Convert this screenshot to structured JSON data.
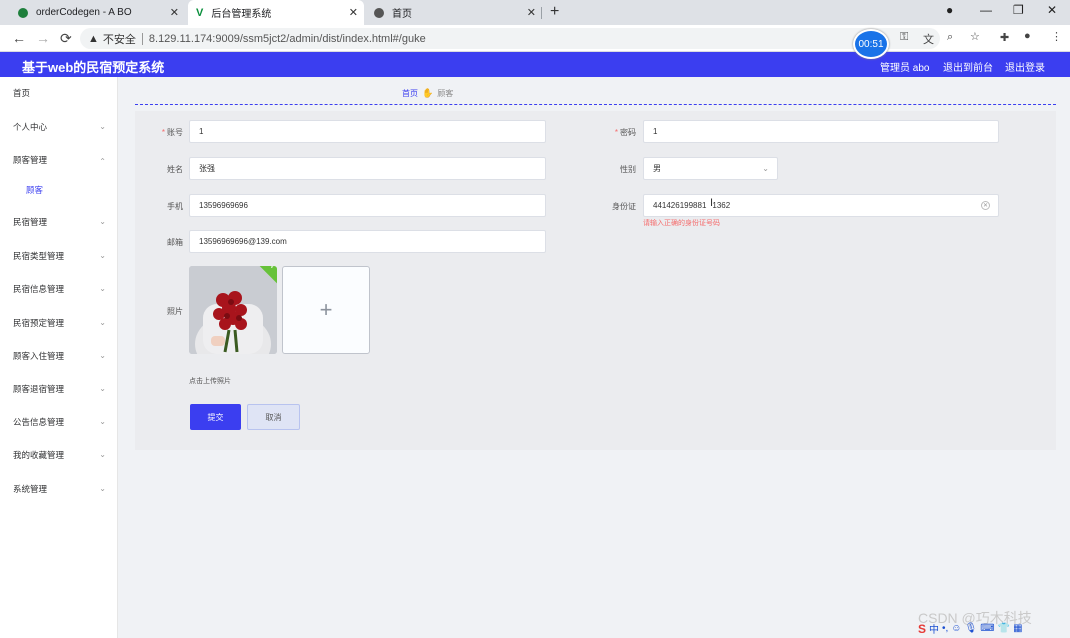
{
  "browser": {
    "tabs": [
      {
        "title": "orderCodegen - A BO",
        "active": false
      },
      {
        "title": "后台管理系统",
        "active": true
      },
      {
        "title": "首页",
        "active": false
      }
    ],
    "new_tab_symbol": "+",
    "address": {
      "security_text": "不安全",
      "url": "8.129.11.174:9009/ssm5jct2/admin/dist/index.html#/guke"
    },
    "timer": "00:51"
  },
  "header": {
    "title": "基于web的民宿预定系统",
    "user": "管理员 abo",
    "to_front": "退出到前台",
    "logout": "退出登录"
  },
  "sidebar": {
    "items": [
      {
        "label": "首页",
        "expandable": false
      },
      {
        "label": "个人中心",
        "expandable": true
      },
      {
        "label": "顾客管理",
        "expandable": true,
        "open": true
      },
      {
        "label": "顾客",
        "sub": true
      },
      {
        "label": "民宿管理",
        "expandable": true
      },
      {
        "label": "民宿类型管理",
        "expandable": true
      },
      {
        "label": "民宿信息管理",
        "expandable": true
      },
      {
        "label": "民宿预定管理",
        "expandable": true
      },
      {
        "label": "顾客入住管理",
        "expandable": true
      },
      {
        "label": "顾客退宿管理",
        "expandable": true
      },
      {
        "label": "公告信息管理",
        "expandable": true
      },
      {
        "label": "我的收藏管理",
        "expandable": true
      },
      {
        "label": "系统管理",
        "expandable": true
      }
    ]
  },
  "breadcrumb": {
    "home": "首页",
    "current": "顾客"
  },
  "form": {
    "account": {
      "label": "账号",
      "value": "1",
      "required": true
    },
    "password": {
      "label": "密码",
      "value": "1",
      "required": true
    },
    "name": {
      "label": "姓名",
      "value": "张强"
    },
    "gender": {
      "label": "性别",
      "value": "男"
    },
    "phone": {
      "label": "手机",
      "value": "13596969696"
    },
    "id_card": {
      "label": "身份证",
      "value": "441426199881",
      "value_tail": "1362",
      "error": "请输入正确的身份证号码"
    },
    "email": {
      "label": "邮箱",
      "value": "13596969696@139.com"
    },
    "photo": {
      "label": "照片",
      "tip": "点击上传照片"
    },
    "submit": "提交",
    "cancel": "取消"
  },
  "watermark": "CSDN @巧木科技",
  "tray": {
    "ime": "中"
  },
  "colors": {
    "primary": "#3b3ef0",
    "error": "#f56c6c",
    "success": "#67c23a"
  }
}
